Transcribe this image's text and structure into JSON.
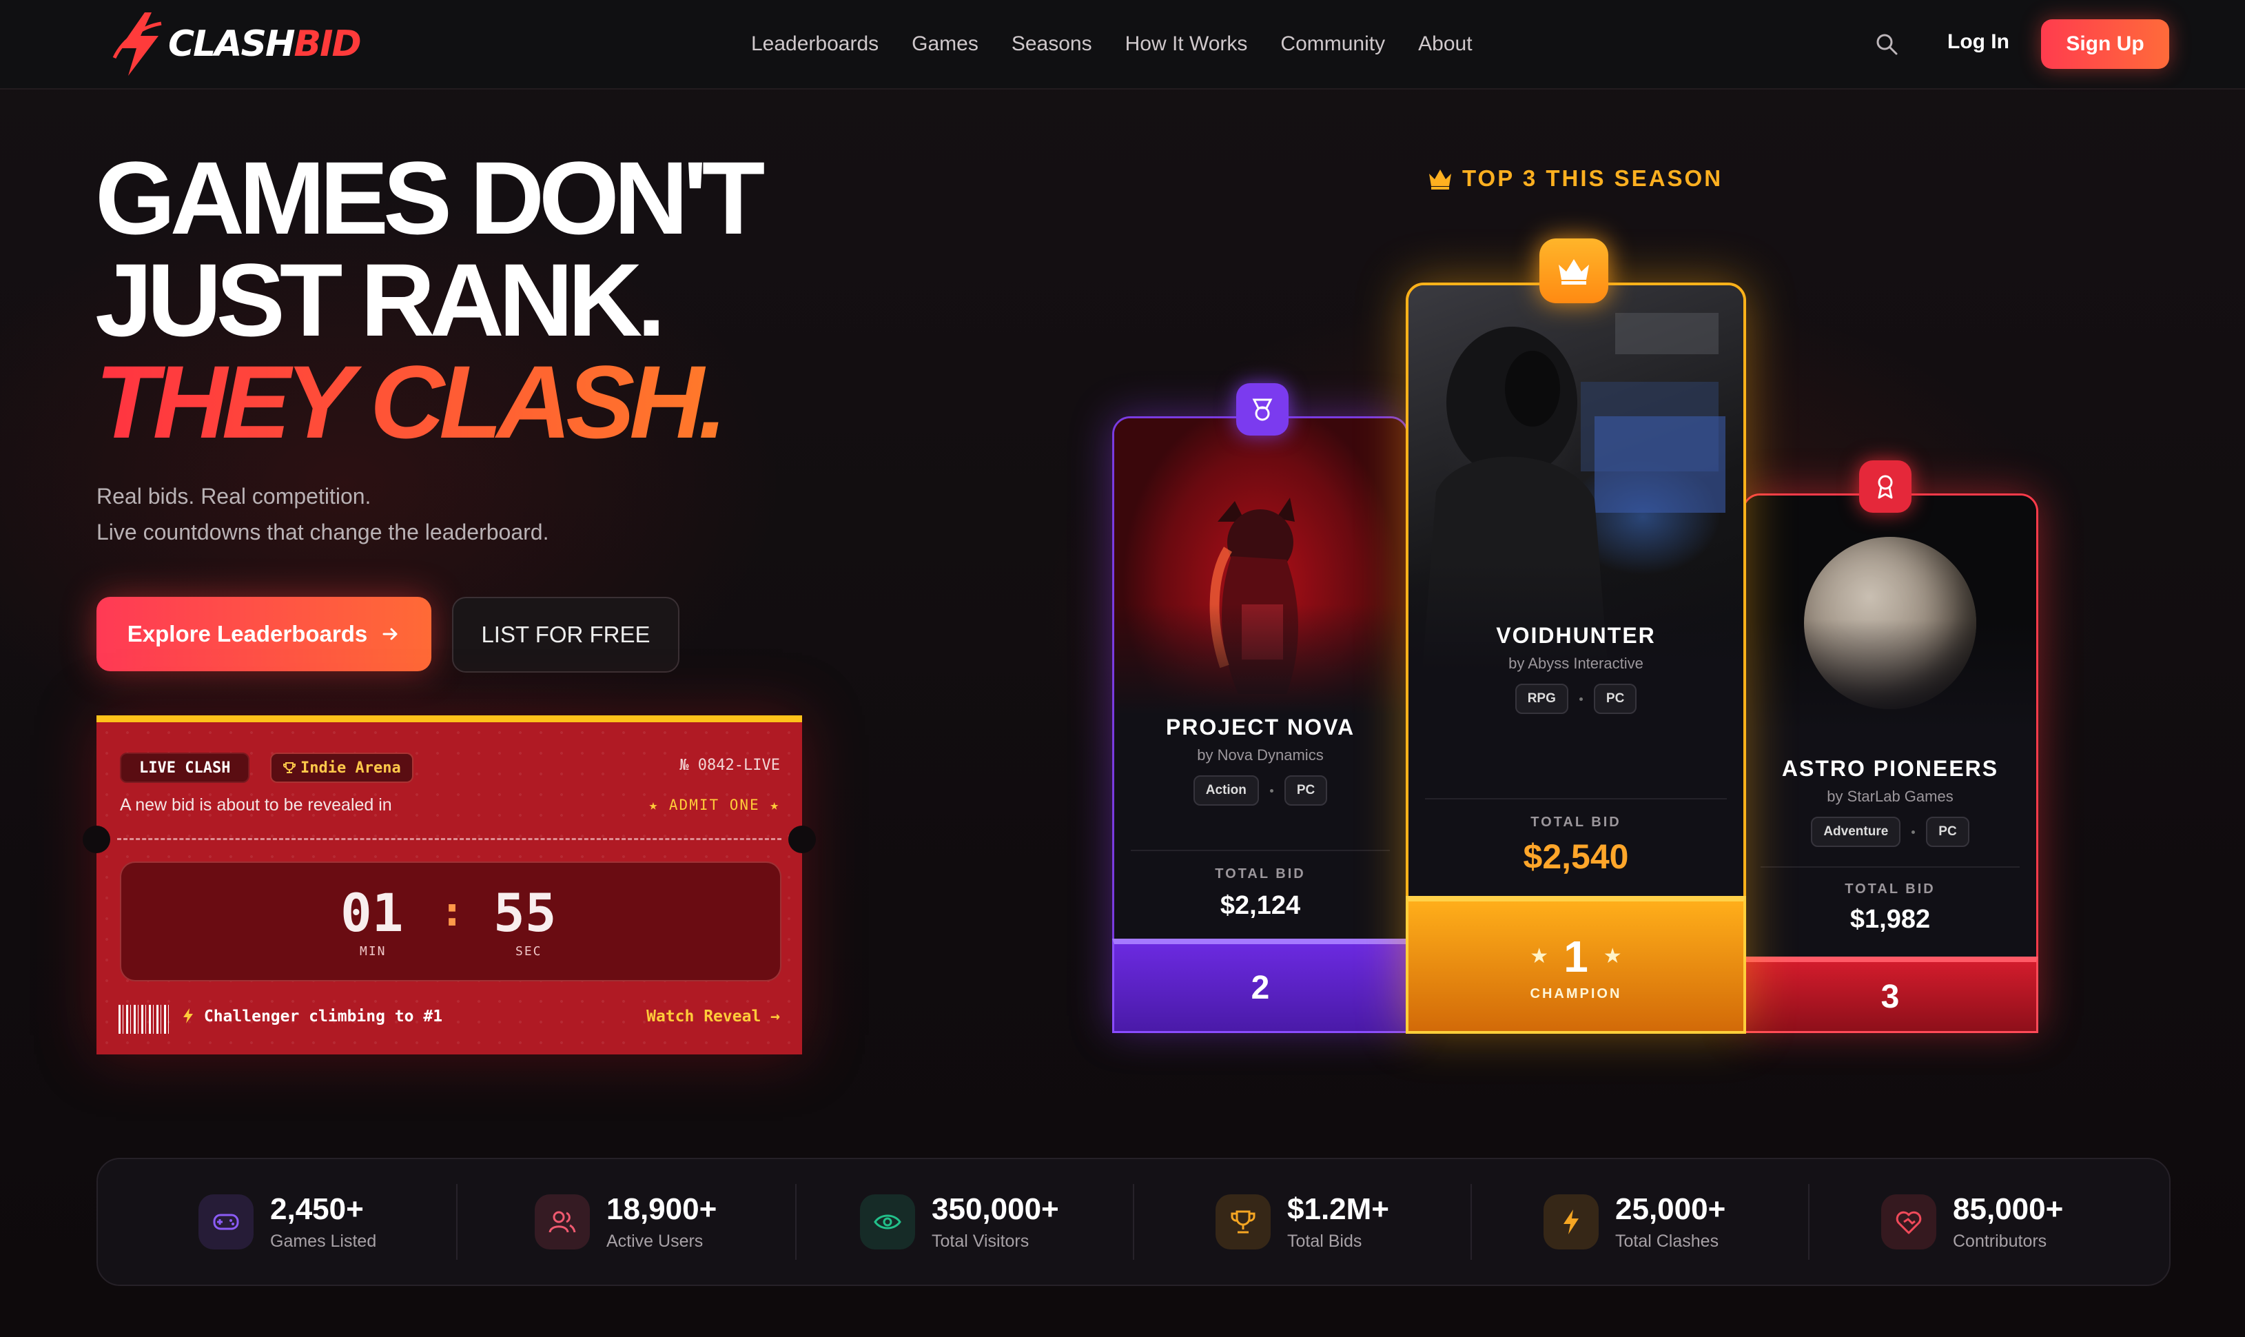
{
  "brand": {
    "name_part1": "CLASH",
    "name_part2": "BID",
    "accent": "#ff3b3b"
  },
  "nav": {
    "links": [
      "Leaderboards",
      "Games",
      "Seasons",
      "How It Works",
      "Community",
      "About"
    ],
    "search_icon": "search-icon",
    "login": "Log In",
    "signup": "Sign Up"
  },
  "hero": {
    "line1": "GAMES DON'T",
    "line2": "JUST RANK.",
    "line3": "THEY CLASH.",
    "sub1": "Real bids. Real competition.",
    "sub2": "Live countdowns that change the leaderboard.",
    "cta_primary": "Explore Leaderboards",
    "cta_secondary": "LIST FOR FREE"
  },
  "ticket": {
    "live_badge": "LIVE CLASH",
    "arena_badge": "Indie Arena",
    "ticket_id": "№ 0842-LIVE",
    "message": "A new bid is about to be revealed in",
    "admit": "★ ADMIT ONE ★",
    "minutes": "01",
    "seconds": "55",
    "min_label": "MIN",
    "sec_label": "SEC",
    "separator": ":",
    "climbing": "Challenger climbing to #1",
    "watch": "Watch Reveal →"
  },
  "podium": {
    "heading": "TOP 3 THIS SEASON",
    "total_bid_label": "TOTAL BID",
    "champion_label": "CHAMPION",
    "games": [
      {
        "rank": "1",
        "title": "VOIDHUNTER",
        "by": "by Abyss Interactive",
        "tags": [
          "RPG",
          "PC"
        ],
        "total_bid": "$2,540",
        "color": "#ffb21a"
      },
      {
        "rank": "2",
        "title": "PROJECT NOVA",
        "by": "by Nova Dynamics",
        "tags": [
          "Action",
          "PC"
        ],
        "total_bid": "$2,124",
        "color": "#7a3be0"
      },
      {
        "rank": "3",
        "title": "ASTRO PIONEERS",
        "by": "by StarLab Games",
        "tags": [
          "Adventure",
          "PC"
        ],
        "total_bid": "$1,982",
        "color": "#ff3b4a"
      }
    ]
  },
  "stats": [
    {
      "value": "2,450+",
      "label": "Games Listed",
      "icon": "gamepad-icon",
      "color": "#8b5cf6"
    },
    {
      "value": "18,900+",
      "label": "Active Users",
      "icon": "users-icon",
      "color": "#f05a70"
    },
    {
      "value": "350,000+",
      "label": "Total Visitors",
      "icon": "eye-icon",
      "color": "#22c08a"
    },
    {
      "value": "$1.2M+",
      "label": "Total Bids",
      "icon": "trophy-icon",
      "color": "#f5a623"
    },
    {
      "value": "25,000+",
      "label": "Total Clashes",
      "icon": "lightning-icon",
      "color": "#f5a623"
    },
    {
      "value": "85,000+",
      "label": "Contributors",
      "icon": "heart-handshake-icon",
      "color": "#f04a5a"
    }
  ]
}
